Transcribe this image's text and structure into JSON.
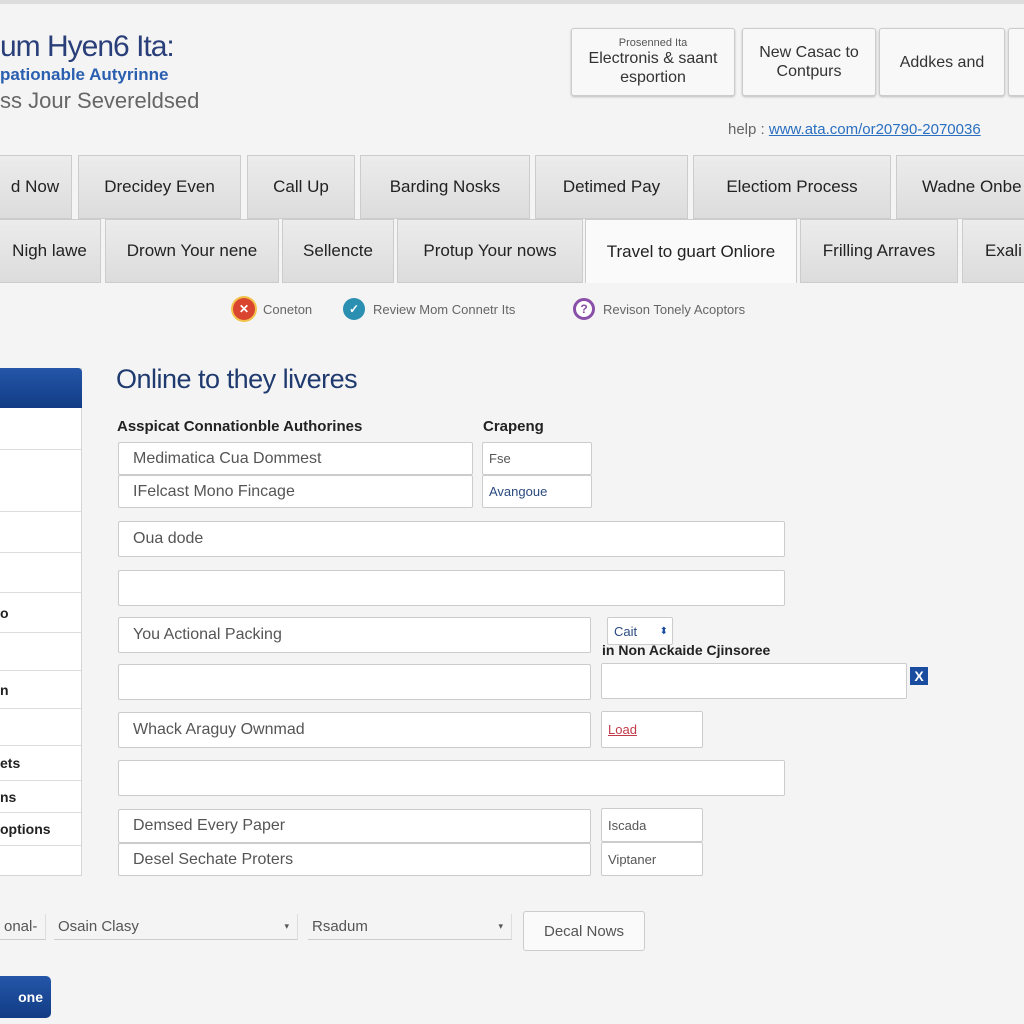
{
  "brand": {
    "title": "um Hyen6 Ita:",
    "subtitle": "pationable Autyrinne",
    "tagline": "ss Jour Severeldsed"
  },
  "header_buttons": [
    {
      "caption": "Prosenned Ita",
      "label": "Electronis & saant esportion"
    },
    {
      "label": "New Casac to Contpurs"
    },
    {
      "label": "Addkes and"
    }
  ],
  "help": {
    "label": "help :",
    "link": "www.ata.com/or20790-2070036"
  },
  "tabs_row1": [
    "d Now",
    "Drecidey Even",
    "Call Up",
    "Barding Nosks",
    "Detimed Pay",
    "Electiom Process",
    "Wadne Onbe"
  ],
  "tabs_row2": [
    "Nigh lawe",
    "Drown Your nene",
    "Sellencte",
    "Protup Your nows",
    "Travel to guart Onliore",
    "Frilling Arraves",
    "Exali"
  ],
  "active_tab": "Travel to guart Onliore",
  "status": [
    {
      "icon": "x-circle-icon",
      "label": "Coneton",
      "color": "#d9452e"
    },
    {
      "icon": "check-circle-icon",
      "label": "Review Mom Connetr Its",
      "color": "#2a8fb0"
    },
    {
      "icon": "info-circle-icon",
      "label": "Revison Tonely Acoptors",
      "color": "#8a4fa8"
    }
  ],
  "sidebar": {
    "items": [
      "",
      "",
      "",
      "",
      "o",
      "",
      "n",
      "",
      "ets",
      "ns",
      "options",
      ""
    ]
  },
  "form": {
    "title": "Online to they liveres",
    "label_main": "Asspicat Connationble Authorines",
    "label_side": "Crapeng",
    "fields": {
      "f1": "Medimatica Cua Dommest",
      "f1_side": "Fse",
      "f2": "IFelcast Mono Fincage",
      "f2_side": "Avangoue",
      "f3": "Oua dode",
      "f4": "",
      "f5": "You Actional Packing",
      "f5_select": "Cait",
      "side_label": "in Non Ackaide Cjinsoree",
      "f6": "",
      "f6_side": "",
      "f7": "Whack Araguy Ownmad",
      "f7_side": "Load",
      "f8": "",
      "f9": "Demsed Every Paper",
      "f9_side": "Iscada",
      "f10": "Desel Sechate Proters",
      "f10_side": "Viptaner"
    },
    "close_label": "X"
  },
  "bottom": {
    "select0": "onal-",
    "select1": "Osain Clasy",
    "select2": "Rsadum",
    "button": "Decal Nows",
    "primary": "one"
  },
  "colors": {
    "accent": "#1a4da0",
    "title": "#1e3a6e"
  }
}
